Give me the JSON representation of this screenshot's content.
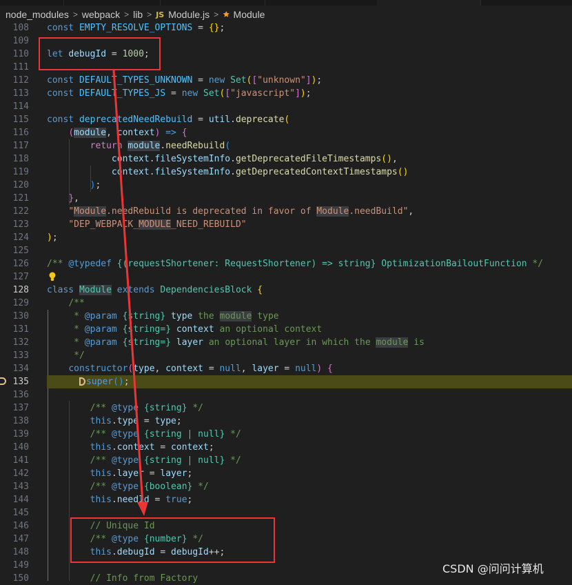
{
  "breadcrumb": {
    "items": [
      "node_modules",
      "webpack",
      "lib"
    ],
    "file_badge": "JS",
    "file": "Module.js",
    "symbol_icon": "class-symbol-icon",
    "symbol": "Module",
    "separator": ">"
  },
  "editor": {
    "current_line": 135,
    "line_numbers": [
      "108",
      "109",
      "110",
      "111",
      "112",
      "113",
      "114",
      "115",
      "116",
      "117",
      "118",
      "119",
      "120",
      "121",
      "122",
      "123",
      "124",
      "125",
      "126",
      "127",
      "128",
      "129",
      "130",
      "131",
      "132",
      "133",
      "134",
      "135",
      "136",
      "137",
      "138",
      "139",
      "140",
      "141",
      "142",
      "143",
      "144",
      "145",
      "146",
      "147",
      "148",
      "149",
      "150"
    ],
    "icons": {
      "lightbulb": "lightbulb-icon",
      "debug_pointer": "debug-stack-frame-icon"
    }
  },
  "watermark": "CSDN @问问计算机",
  "colors": {
    "background": "#1f1f1f",
    "debug_highlight": "#4b4b18",
    "annotation_red": "#ee3535"
  }
}
